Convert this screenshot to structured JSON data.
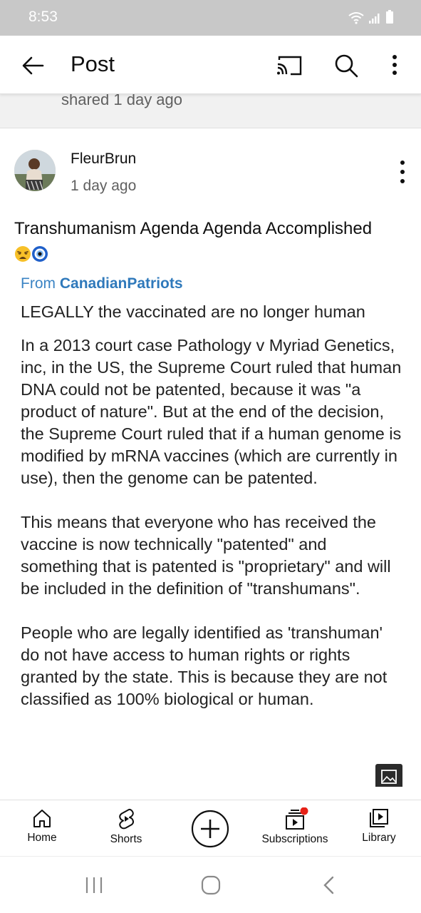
{
  "status_bar": {
    "time": "8:53"
  },
  "app_bar": {
    "title": "Post",
    "back_icon": "arrow-left-icon",
    "cast_icon": "cast-icon",
    "search_icon": "search-icon",
    "more_icon": "more-vertical-icon"
  },
  "shared": {
    "text": "shared 1 day ago"
  },
  "post": {
    "author": "FleurBrun",
    "time_ago": "1 day ago",
    "text": "Transhumanism Agenda Agenda Accomplished",
    "emojis": [
      "weary-face-emoji",
      "nazar-amulet-emoji"
    ],
    "image": {
      "from_prefix": "From",
      "from_source": "CanadianPatriots",
      "headline": "LEGALLY the vaccinated are no longer human",
      "paragraphs": [
        "In a 2013 court case Pathology v Myriad Genetics, inc, in the US, the Supreme Court ruled that human DNA could not be patented, because it was \"a product of nature\". But at the end of the decision, the Supreme Court ruled that if a human genome is modified by mRNA vaccines (which are currently in use), then the genome can be patented.",
        "This means that everyone who has received the vaccine is now technically \"patented\" and something that is patented is \"proprietary\" and will be included in the definition of \"transhumans\".",
        "People who are legally identified as 'transhuman' do not have access to human rights or rights granted by the state. This is because they are not classified as 100% biological or human."
      ]
    }
  },
  "bottom_nav": {
    "items": [
      {
        "label": "Home",
        "icon": "home-icon"
      },
      {
        "label": "Shorts",
        "icon": "shorts-icon"
      },
      {
        "label": "",
        "icon": "create-plus-icon"
      },
      {
        "label": "Subscriptions",
        "icon": "subscriptions-icon"
      },
      {
        "label": "Library",
        "icon": "library-icon"
      }
    ]
  },
  "colors": {
    "link_blue": "#3b84c4",
    "notification_red": "#e62117",
    "status_bar_gray": "#c8c8c8"
  }
}
